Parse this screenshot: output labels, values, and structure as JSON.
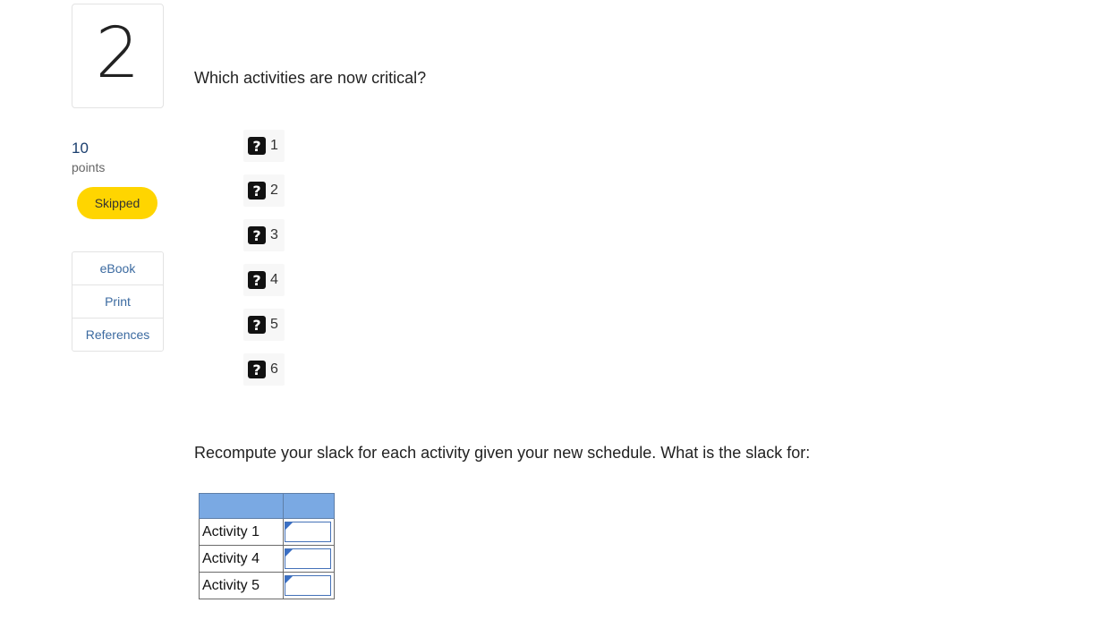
{
  "question_number": "2",
  "points": {
    "value": "10",
    "label": "points"
  },
  "status_badge": "Skipped",
  "resources": [
    "eBook",
    "Print",
    "References"
  ],
  "question_text": "Which activities are now critical?",
  "options": [
    {
      "icon": "question-mark-icon",
      "label": "1"
    },
    {
      "icon": "question-mark-icon",
      "label": "2"
    },
    {
      "icon": "question-mark-icon",
      "label": "3"
    },
    {
      "icon": "question-mark-icon",
      "label": "4"
    },
    {
      "icon": "question-mark-icon",
      "label": "5"
    },
    {
      "icon": "question-mark-icon",
      "label": "6"
    }
  ],
  "question2_text": "Recompute your slack for each activity given your new schedule. What is the slack for:",
  "slack_table": {
    "headers": [
      "",
      ""
    ],
    "rows": [
      {
        "label": "Activity 1",
        "value": ""
      },
      {
        "label": "Activity 4",
        "value": ""
      },
      {
        "label": "Activity 5",
        "value": ""
      }
    ]
  },
  "colors": {
    "badge": "#ffd500",
    "table_header": "#7aa9e3",
    "link": "#3b6aa0"
  }
}
